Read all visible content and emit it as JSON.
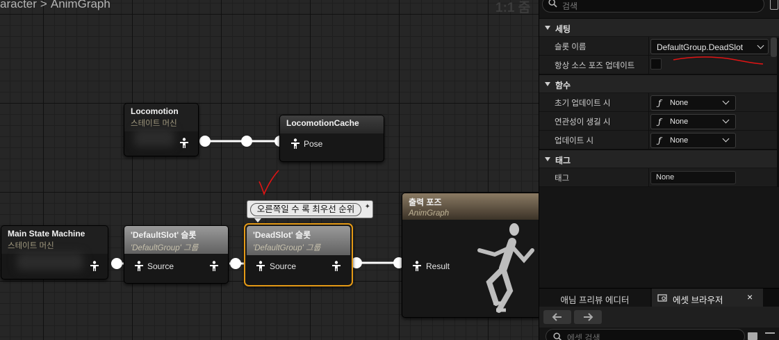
{
  "graph": {
    "breadcrumb": [
      "aracter",
      "AnimGraph"
    ],
    "breadcrumb_sep": ">",
    "zoom": "1:1 줌"
  },
  "nodes": {
    "locomotion": {
      "title": "Locomotion",
      "subtitle": "스테이트 머신"
    },
    "locomotion_cache": {
      "title": "LocomotionCache",
      "pin": "Pose"
    },
    "main_state_machine": {
      "title": "Main State Machine",
      "subtitle": "스테이트 머신"
    },
    "default_slot": {
      "title": "'DefaultSlot' 슬롯",
      "subtitle": "'DefaultGroup' 그룹",
      "pin": "Source"
    },
    "dead_slot": {
      "title": "'DeadSlot' 슬롯",
      "subtitle": "'DefaultGroup' 그룹",
      "pin": "Source"
    },
    "output_pose": {
      "title": "출력 포즈",
      "subtitle": "AnimGraph",
      "pin": "Result"
    }
  },
  "comment": {
    "text": "오른쪽일 수 록 최우선 순위"
  },
  "details": {
    "search_placeholder": "검색",
    "sections": [
      {
        "title": "세팅",
        "rows": [
          {
            "label": "슬롯 이름",
            "value": "DefaultGroup.DeadSlot"
          },
          {
            "label": "항상 소스 포즈 업데이트",
            "checked": false
          }
        ]
      },
      {
        "title": "함수",
        "rows": [
          {
            "label": "초기 업데이트 시",
            "value": "None"
          },
          {
            "label": "연관성이 생길 시",
            "value": "None"
          },
          {
            "label": "업데이트 시",
            "value": "None"
          }
        ]
      },
      {
        "title": "태그",
        "rows": [
          {
            "label": "태그",
            "value": "None"
          }
        ]
      }
    ],
    "function_icon": "ƒ"
  },
  "bottom_tabs": [
    {
      "label": "애님 프리뷰 에디터"
    },
    {
      "label": "에셋 브라우저",
      "close": "×"
    }
  ],
  "asset_search_placeholder": "에셋 검색",
  "colors": {
    "accent_orange": "#e59a16",
    "red_annotation": "#e01414",
    "graph_bg": "#262626"
  }
}
